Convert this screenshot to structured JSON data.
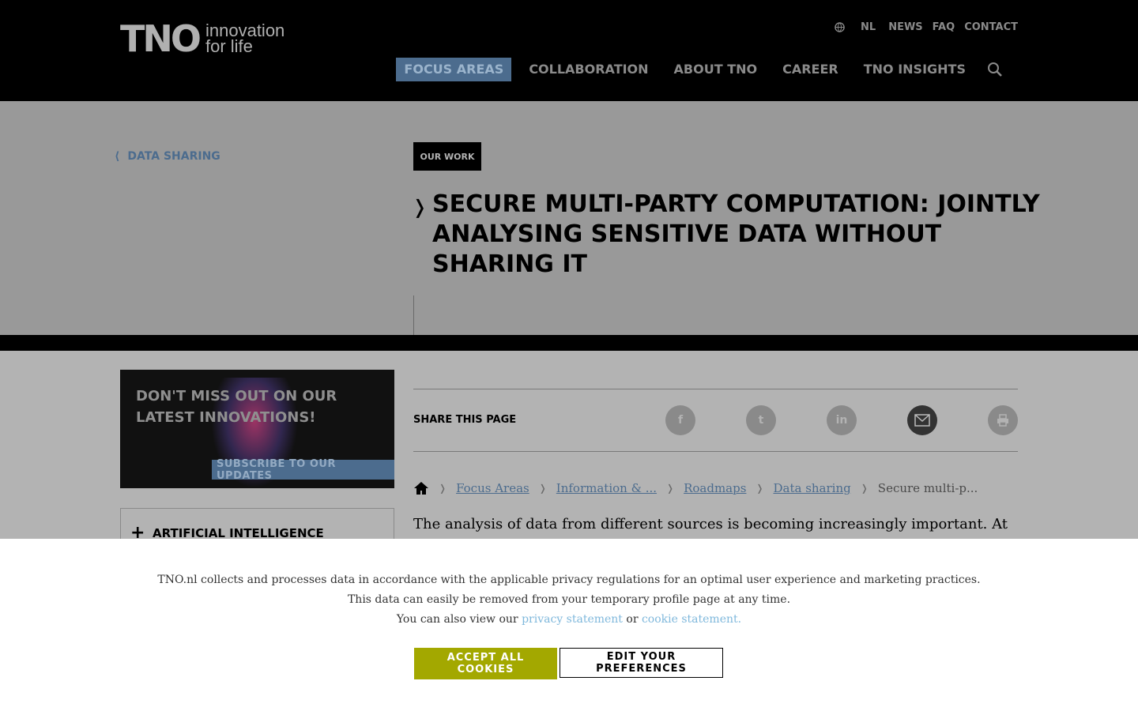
{
  "header": {
    "logo_mark": "TNO",
    "logo_tagline_1": "innovation",
    "logo_tagline_2": "for life",
    "utility": {
      "language": "NL",
      "news": "NEWS",
      "faq": "FAQ",
      "contact": "CONTACT",
      "globe_icon": "globe-icon"
    },
    "nav": [
      {
        "label": "FOCUS AREAS",
        "active": true
      },
      {
        "label": "COLLABORATION"
      },
      {
        "label": "ABOUT TNO"
      },
      {
        "label": "CAREER"
      },
      {
        "label": "TNO INSIGHTS"
      }
    ],
    "search_icon": "search-icon"
  },
  "hero": {
    "back_link": "DATA SHARING",
    "tag": "OUR WORK",
    "title": "SECURE MULTI-PARTY COMPUTATION: JOINTLY ANALYSING SENSITIVE DATA WITHOUT SHARING IT"
  },
  "promo": {
    "title": "DON'T MISS OUT ON OUR LATEST INNOVATIONS!",
    "button": "SUBSCRIBE TO OUR UPDATES"
  },
  "accordion": {
    "label": "ARTIFICIAL INTELLIGENCE"
  },
  "share": {
    "label": "SHARE THIS PAGE",
    "icons": [
      "facebook-icon",
      "twitter-icon",
      "linkedin-icon",
      "mail-icon",
      "print-icon"
    ]
  },
  "breadcrumb": {
    "items": [
      "Focus Areas",
      "Information & ...",
      "Roadmaps",
      "Data sharing"
    ],
    "current": "Secure multi-p..."
  },
  "content": {
    "lead": "The analysis of data from different sources is becoming increasingly important. At the"
  },
  "cookie": {
    "line1": "TNO.nl collects and processes data in accordance with the applicable privacy regulations for an optimal user experience and marketing practices.",
    "line2": "This data can easily be removed from your temporary profile page at any time.",
    "line3_prefix": "You can also view our",
    "privacy_link": "privacy statement",
    "or_text": "or",
    "cookie_link": "cookie statement.",
    "accept": "ACCEPT ALL COOKIES",
    "edit": "EDIT YOUR PREFERENCES"
  },
  "colors": {
    "accent_blue": "#4c6c8e",
    "accept_green": "#a3a800",
    "link_blue": "#7fb8dc"
  }
}
